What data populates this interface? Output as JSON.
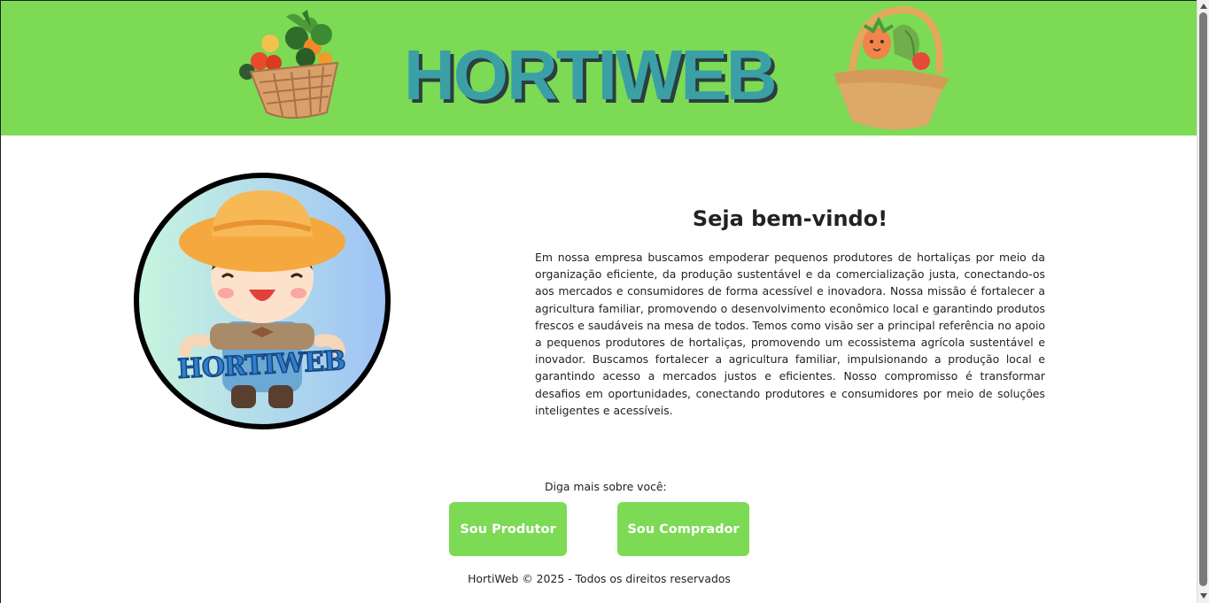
{
  "header": {
    "logo_text": "HORTIWEB",
    "background_color": "#7cda55",
    "logo_color": "#3aa0a6"
  },
  "avatar": {
    "badge_text": "HORTIWEB"
  },
  "welcome": {
    "title": "Seja bem-vindo!",
    "body": "Em nossa empresa buscamos empoderar pequenos produtores de hortaliças por meio da organização eficiente, da produção sustentável e da comercialização justa, conectando-os aos mercados e consumidores de forma acessível e inovadora. Nossa missão é fortalecer a agricultura familiar, promovendo o desenvolvimento econômico local e garantindo produtos frescos e saudáveis na mesa de todos. Temos como visão ser a principal referência no apoio a pequenos produtores de hortaliças, promovendo um ecossistema agrícola sustentável e inovador. Buscamos fortalecer a agricultura familiar, impulsionando a produção local e garantindo acesso a mercados justos e eficientes. Nosso compromisso é transformar desafios em oportunidades, conectando produtores e consumidores por meio de soluções inteligentes e acessíveis."
  },
  "choice": {
    "prompt": "Diga mais sobre você:",
    "producer_label": "Sou Produtor",
    "buyer_label": "Sou Comprador",
    "button_color": "#7cda55"
  },
  "footer": {
    "text": "HortiWeb © 2025 - Todos os direitos reservados"
  }
}
